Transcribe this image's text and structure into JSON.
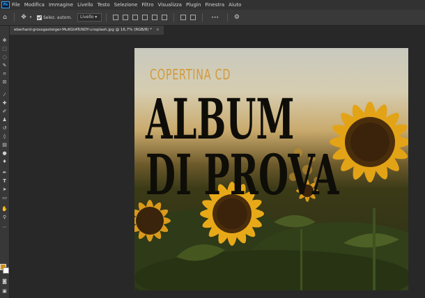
{
  "app": {
    "logo": "Ps",
    "menu": [
      "File",
      "Modifica",
      "Immagine",
      "Livello",
      "Testo",
      "Selezione",
      "Filtro",
      "Visualizza",
      "Plugin",
      "Finestra",
      "Aiuto"
    ]
  },
  "options": {
    "auto_select_label": "Selez. autom.",
    "layer_dropdown": "Livello",
    "more": "•••"
  },
  "document": {
    "tab_title": "eberhard-grossgasteiger-MuKGtATcNDY-unsplash.jpg @ 16,7% (RGB/8) *",
    "close": "×"
  },
  "artwork": {
    "line1": "COPERTINA CD",
    "line2": "ALBUM",
    "line3": "DI PROVA"
  },
  "colors": {
    "foreground": "#d48f0c",
    "background": "#ffffff",
    "title_color": "#d29a3c",
    "text_color": "#0f0d08"
  },
  "tools": [
    "move-icon",
    "marquee-icon",
    "lasso-icon",
    "quick-select-icon",
    "crop-icon",
    "frame-icon",
    "eyedropper-icon",
    "healing-icon",
    "brush-icon",
    "stamp-icon",
    "history-brush-icon",
    "eraser-icon",
    "gradient-icon",
    "blur-icon",
    "dodge-icon",
    "pen-icon",
    "type-icon",
    "path-select-icon",
    "rectangle-icon",
    "hand-icon",
    "zoom-icon",
    "more-tools-icon"
  ]
}
